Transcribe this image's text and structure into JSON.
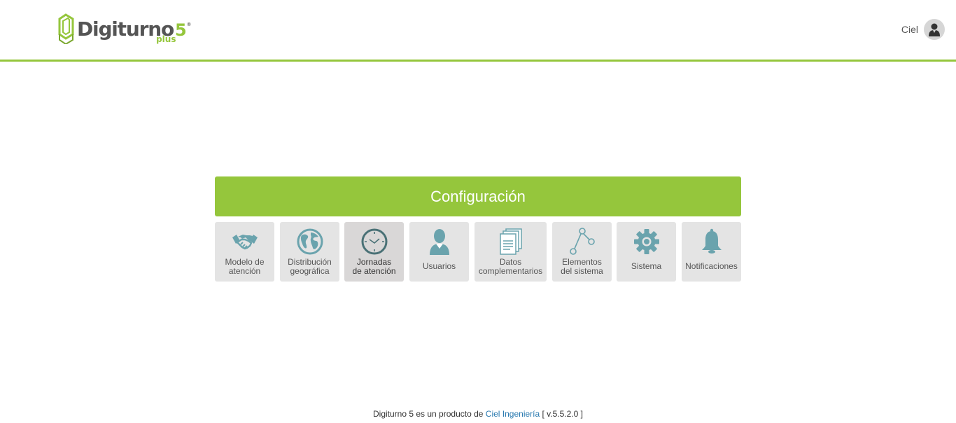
{
  "header": {
    "logo": {
      "name": "Digiturno",
      "version": "5",
      "registered": "®",
      "edition": "plus"
    },
    "user": {
      "name": "Ciel"
    }
  },
  "panel": {
    "title": "Configuración",
    "tiles": [
      {
        "line1": "Modelo de",
        "line2": "atención",
        "icon": "handshake-icon"
      },
      {
        "line1": "Distribución",
        "line2": "geográfica",
        "icon": "globe-icon"
      },
      {
        "line1": "Jornadas",
        "line2": "de atención",
        "icon": "clock-icon",
        "active": true
      },
      {
        "line1": "Usuarios",
        "line2": "",
        "icon": "user-icon"
      },
      {
        "line1": "Datos",
        "line2": "complementarios",
        "icon": "documents-icon"
      },
      {
        "line1": "Elementos",
        "line2": "del sistema",
        "icon": "nodes-icon"
      },
      {
        "line1": "Sistema",
        "line2": "",
        "icon": "gear-icon"
      },
      {
        "line1": "Notificaciones",
        "line2": "",
        "icon": "bell-icon"
      }
    ]
  },
  "footer": {
    "text": "Digiturno 5 es un producto de",
    "link": "Ciel Ingeniería",
    "version": "[ v.5.5.2.0 ]"
  },
  "colors": {
    "accent": "#95c63c",
    "icon": "#6aa3ad",
    "tile": "#e4e4e4",
    "link": "#2a7ab0"
  }
}
